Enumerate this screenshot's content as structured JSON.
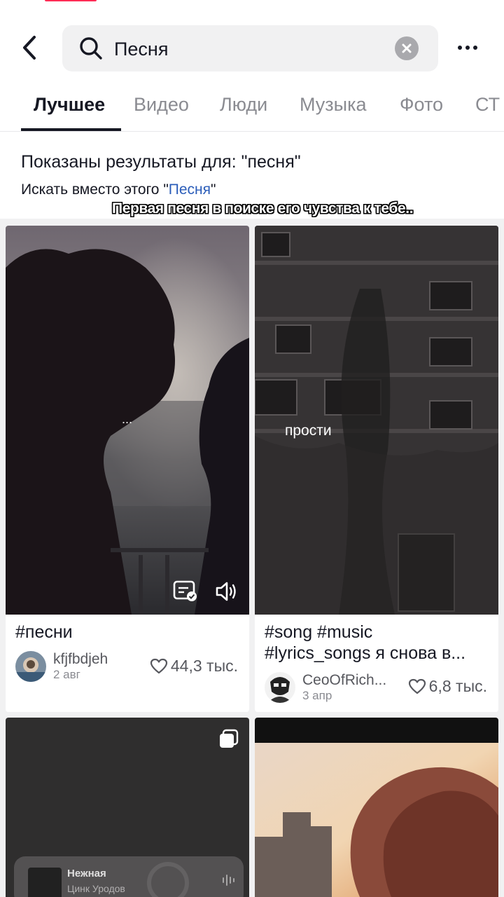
{
  "search": {
    "query": "Песня"
  },
  "tabs": [
    {
      "label": "Лучшее",
      "active": true
    },
    {
      "label": "Видео"
    },
    {
      "label": "Люди"
    },
    {
      "label": "Музыка"
    },
    {
      "label": "Фото"
    },
    {
      "label": "СТ"
    }
  ],
  "suggestion": {
    "main": "Показаны результаты для: \"песня\"",
    "alt_prefix": "Искать вместо этого \"",
    "alt_link": "Песня",
    "alt_suffix": "\""
  },
  "overlay_caption": "Первая песня в поиске его чувства к тебе..",
  "results": [
    {
      "thumb_text": "...",
      "caption": "#песни",
      "author": "kfjfbdjeh",
      "date": "2 авг",
      "likes": "44,3 тыс."
    },
    {
      "thumb_text": "прости",
      "caption_line1": "#song #music",
      "caption_line2": "#lyrics_songs я снова в...",
      "author": "CeoOfRich...",
      "date": "3 апр",
      "likes": "6,8 тыс."
    },
    {
      "music_title": "Нежная",
      "music_artist": "Цинк Уродов"
    },
    {}
  ],
  "colors": {
    "accent": "#fe2c55",
    "link": "#2b5db9",
    "text": "#161823",
    "muted": "#8a8b91"
  },
  "icons": [
    "back-arrow-icon",
    "search-icon",
    "clear-icon",
    "more-icon",
    "captions-icon",
    "speaker-icon",
    "heart-icon",
    "photo-stack-icon",
    "waveform-icon"
  ]
}
